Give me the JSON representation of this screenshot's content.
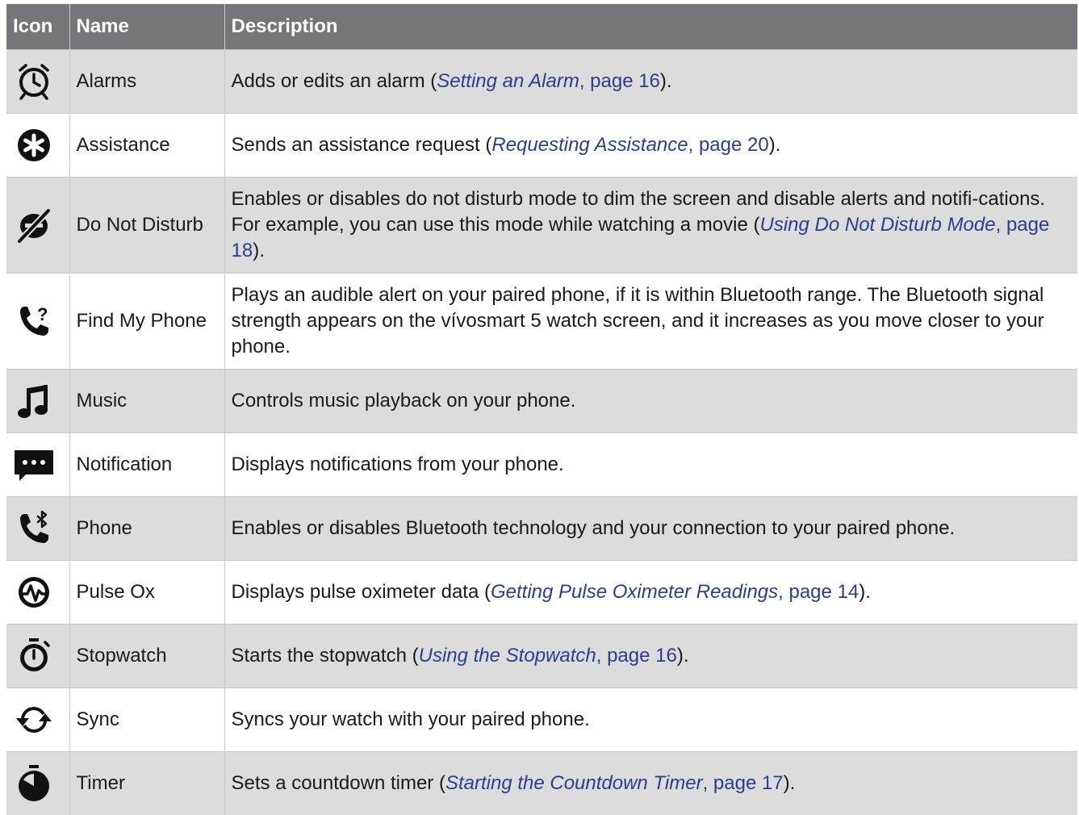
{
  "header": {
    "icon": "Icon",
    "name": "Name",
    "description": "Description"
  },
  "rows": [
    {
      "icon": "alarm-clock-icon",
      "name": "Alarms",
      "desc_pre": "Adds or edits an alarm (",
      "link_title": "Setting an Alarm",
      "link_page": ", page 16",
      "desc_post": ")."
    },
    {
      "icon": "asterisk-circle-icon",
      "name": "Assistance",
      "desc_pre": "Sends an assistance request (",
      "link_title": "Requesting Assistance",
      "link_page": ", page 20",
      "desc_post": ")."
    },
    {
      "icon": "do-not-disturb-icon",
      "name": "Do Not Disturb",
      "desc_pre": "Enables or disables do not disturb mode to dim the screen and disable alerts and notifi-cations. For example, you can use this mode while watching a movie (",
      "link_title": "Using Do Not Disturb Mode",
      "link_page": ", page 18",
      "desc_post": ")."
    },
    {
      "icon": "phone-question-icon",
      "name": "Find My Phone",
      "desc_pre": "Plays an audible alert on your paired phone, if it is within Bluetooth range. The Bluetooth signal strength appears on the vívosmart 5 watch screen, and it increases as you move closer to your phone.",
      "link_title": "",
      "link_page": "",
      "desc_post": ""
    },
    {
      "icon": "music-note-icon",
      "name": "Music",
      "desc_pre": "Controls music playback on your phone.",
      "link_title": "",
      "link_page": "",
      "desc_post": ""
    },
    {
      "icon": "chat-bubble-icon",
      "name": "Notification",
      "desc_pre": "Displays notifications from your phone.",
      "link_title": "",
      "link_page": "",
      "desc_post": ""
    },
    {
      "icon": "phone-bluetooth-icon",
      "name": "Phone",
      "desc_pre": "Enables or disables Bluetooth technology and your connection to your paired phone.",
      "link_title": "",
      "link_page": "",
      "desc_post": ""
    },
    {
      "icon": "pulse-ox-icon",
      "name": "Pulse Ox",
      "desc_pre": "Displays pulse oximeter data (",
      "link_title": "Getting Pulse Oximeter Readings",
      "link_page": ", page 14",
      "desc_post": ")."
    },
    {
      "icon": "stopwatch-icon",
      "name": "Stopwatch",
      "desc_pre": "Starts the stopwatch (",
      "link_title": "Using the Stopwatch",
      "link_page": ", page 16",
      "desc_post": ")."
    },
    {
      "icon": "sync-icon",
      "name": "Sync",
      "desc_pre": "Syncs your watch with your paired phone.",
      "link_title": "",
      "link_page": "",
      "desc_post": ""
    },
    {
      "icon": "timer-icon",
      "name": "Timer",
      "desc_pre": "Sets a countdown timer (",
      "link_title": "Starting the Countdown Timer",
      "link_page": ", page 17",
      "desc_post": ")."
    }
  ],
  "colors": {
    "header_bg": "#747679",
    "shaded_row": "#dcdcdc",
    "link": "#2b3e8e"
  }
}
